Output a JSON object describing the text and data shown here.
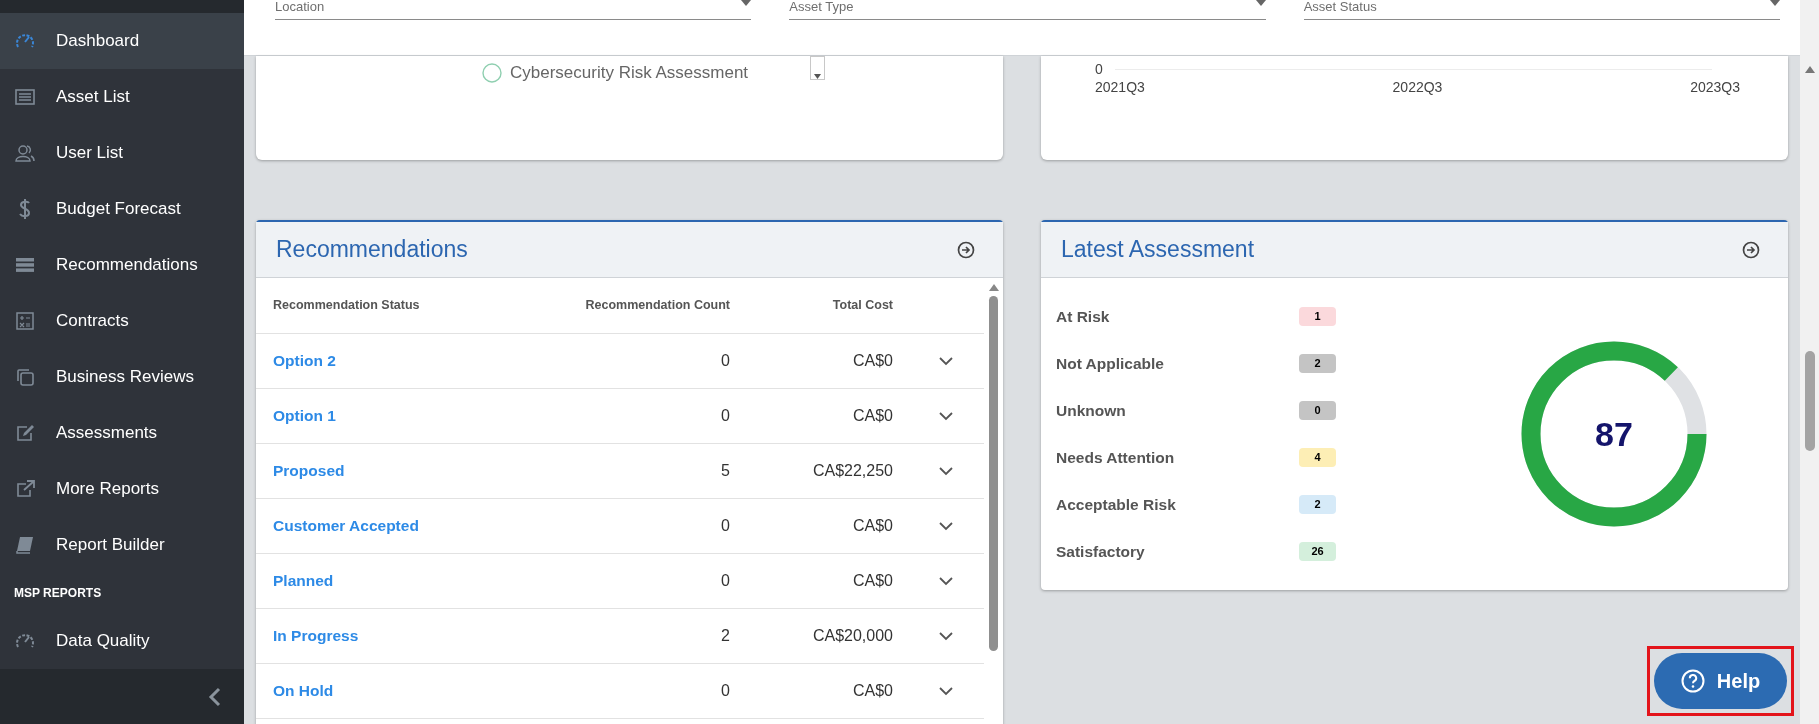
{
  "sidebar": {
    "items": [
      {
        "label": "Dashboard",
        "selected": true
      },
      {
        "label": "Asset List",
        "selected": false
      },
      {
        "label": "User List",
        "selected": false
      },
      {
        "label": "Budget Forecast",
        "selected": false
      },
      {
        "label": "Recommendations",
        "selected": false
      },
      {
        "label": "Contracts",
        "selected": false
      },
      {
        "label": "Business Reviews",
        "selected": false
      },
      {
        "label": "Assessments",
        "selected": false
      },
      {
        "label": "More Reports",
        "selected": false
      },
      {
        "label": "Report Builder",
        "selected": false
      }
    ],
    "section_heading": "MSP REPORTS",
    "section_items": [
      {
        "label": "Data Quality",
        "selected": false
      }
    ]
  },
  "filters": [
    {
      "label": "Location"
    },
    {
      "label": "Asset Type"
    },
    {
      "label": "Asset Status"
    }
  ],
  "legend_card": {
    "legend_items": [
      {
        "label": "Cybersecurity Risk Assessment"
      }
    ]
  },
  "trend_chart": {
    "y_tick": "0",
    "x_ticks": [
      "2021Q3",
      "2022Q3",
      "2023Q3"
    ]
  },
  "recommendations": {
    "title": "Recommendations",
    "columns": [
      "Recommendation Status",
      "Recommendation Count",
      "Total Cost"
    ],
    "rows": [
      {
        "status": "Option 2",
        "count": "0",
        "total_cost": "CA$0"
      },
      {
        "status": "Option 1",
        "count": "0",
        "total_cost": "CA$0"
      },
      {
        "status": "Proposed",
        "count": "5",
        "total_cost": "CA$22,250"
      },
      {
        "status": "Customer Accepted",
        "count": "0",
        "total_cost": "CA$0"
      },
      {
        "status": "Planned",
        "count": "0",
        "total_cost": "CA$0"
      },
      {
        "status": "In Progress",
        "count": "2",
        "total_cost": "CA$20,000"
      },
      {
        "status": "On Hold",
        "count": "0",
        "total_cost": "CA$0"
      }
    ]
  },
  "latest_assessment": {
    "title": "Latest Assessment",
    "score": "87",
    "level": 0.87,
    "categories": [
      {
        "label": "At Risk",
        "count": "1",
        "color": "#fbd9dc"
      },
      {
        "label": "Not Applicable",
        "count": "2",
        "color": "#c4c4c4"
      },
      {
        "label": "Unknown",
        "count": "0",
        "color": "#c4c4c4"
      },
      {
        "label": "Needs Attention",
        "count": "4",
        "color": "#fdeeb5"
      },
      {
        "label": "Acceptable Risk",
        "count": "2",
        "color": "#d6eaf8"
      },
      {
        "label": "Satisfactory",
        "count": "26",
        "color": "#d4efdc"
      }
    ]
  },
  "help_button": {
    "label": "Help"
  }
}
